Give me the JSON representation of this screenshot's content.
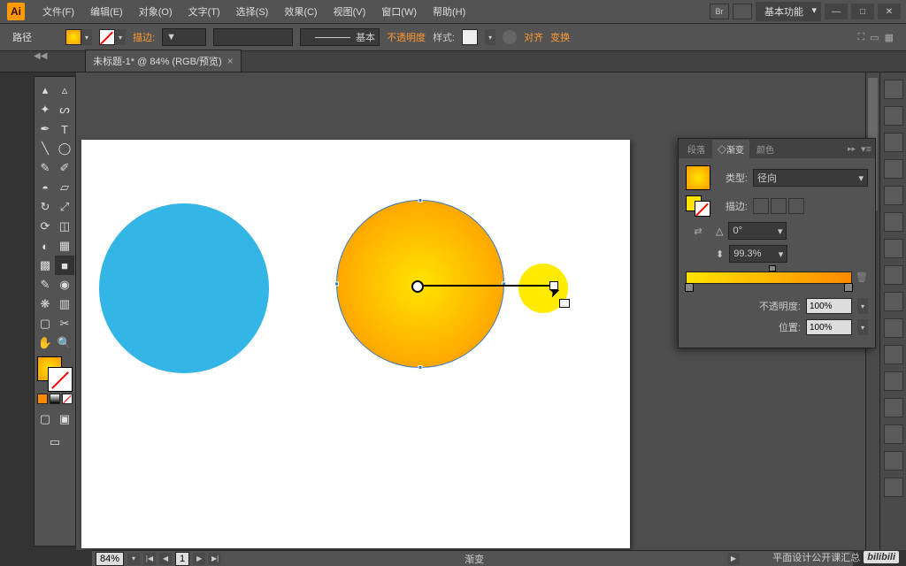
{
  "menubar": {
    "items": [
      "文件(F)",
      "编辑(E)",
      "对象(O)",
      "文字(T)",
      "选择(S)",
      "效果(C)",
      "视图(V)",
      "窗口(W)",
      "帮助(H)"
    ],
    "workspace": "基本功能"
  },
  "control_bar": {
    "selection_label": "路径",
    "stroke_label": "描边:",
    "stroke_weight": "▼",
    "brush_label": "基本",
    "opacity_label": "不透明度",
    "style_label": "样式:",
    "align_label": "对齐",
    "transform_label": "变换"
  },
  "document": {
    "tab_title": "未标题-1* @ 84% (RGB/预览)"
  },
  "gradient_panel": {
    "tabs": [
      "段落",
      "◇渐变",
      "颜色"
    ],
    "type_label": "类型:",
    "type_value": "径向",
    "stroke_label": "描边:",
    "angle_value": "0°",
    "aspect_value": "99.3%",
    "opacity_label": "不透明度:",
    "opacity_value": "100%",
    "location_label": "位置:",
    "location_value": "100%"
  },
  "status_bar": {
    "zoom": "84%",
    "artboard": "1",
    "tool": "渐变"
  },
  "watermark": "平面设计公开课汇总",
  "colors": {
    "blue": "#33b5e5",
    "yellow": "#ffeb00",
    "grad_inner": "#ffe400",
    "grad_outer": "#ff8a00"
  }
}
